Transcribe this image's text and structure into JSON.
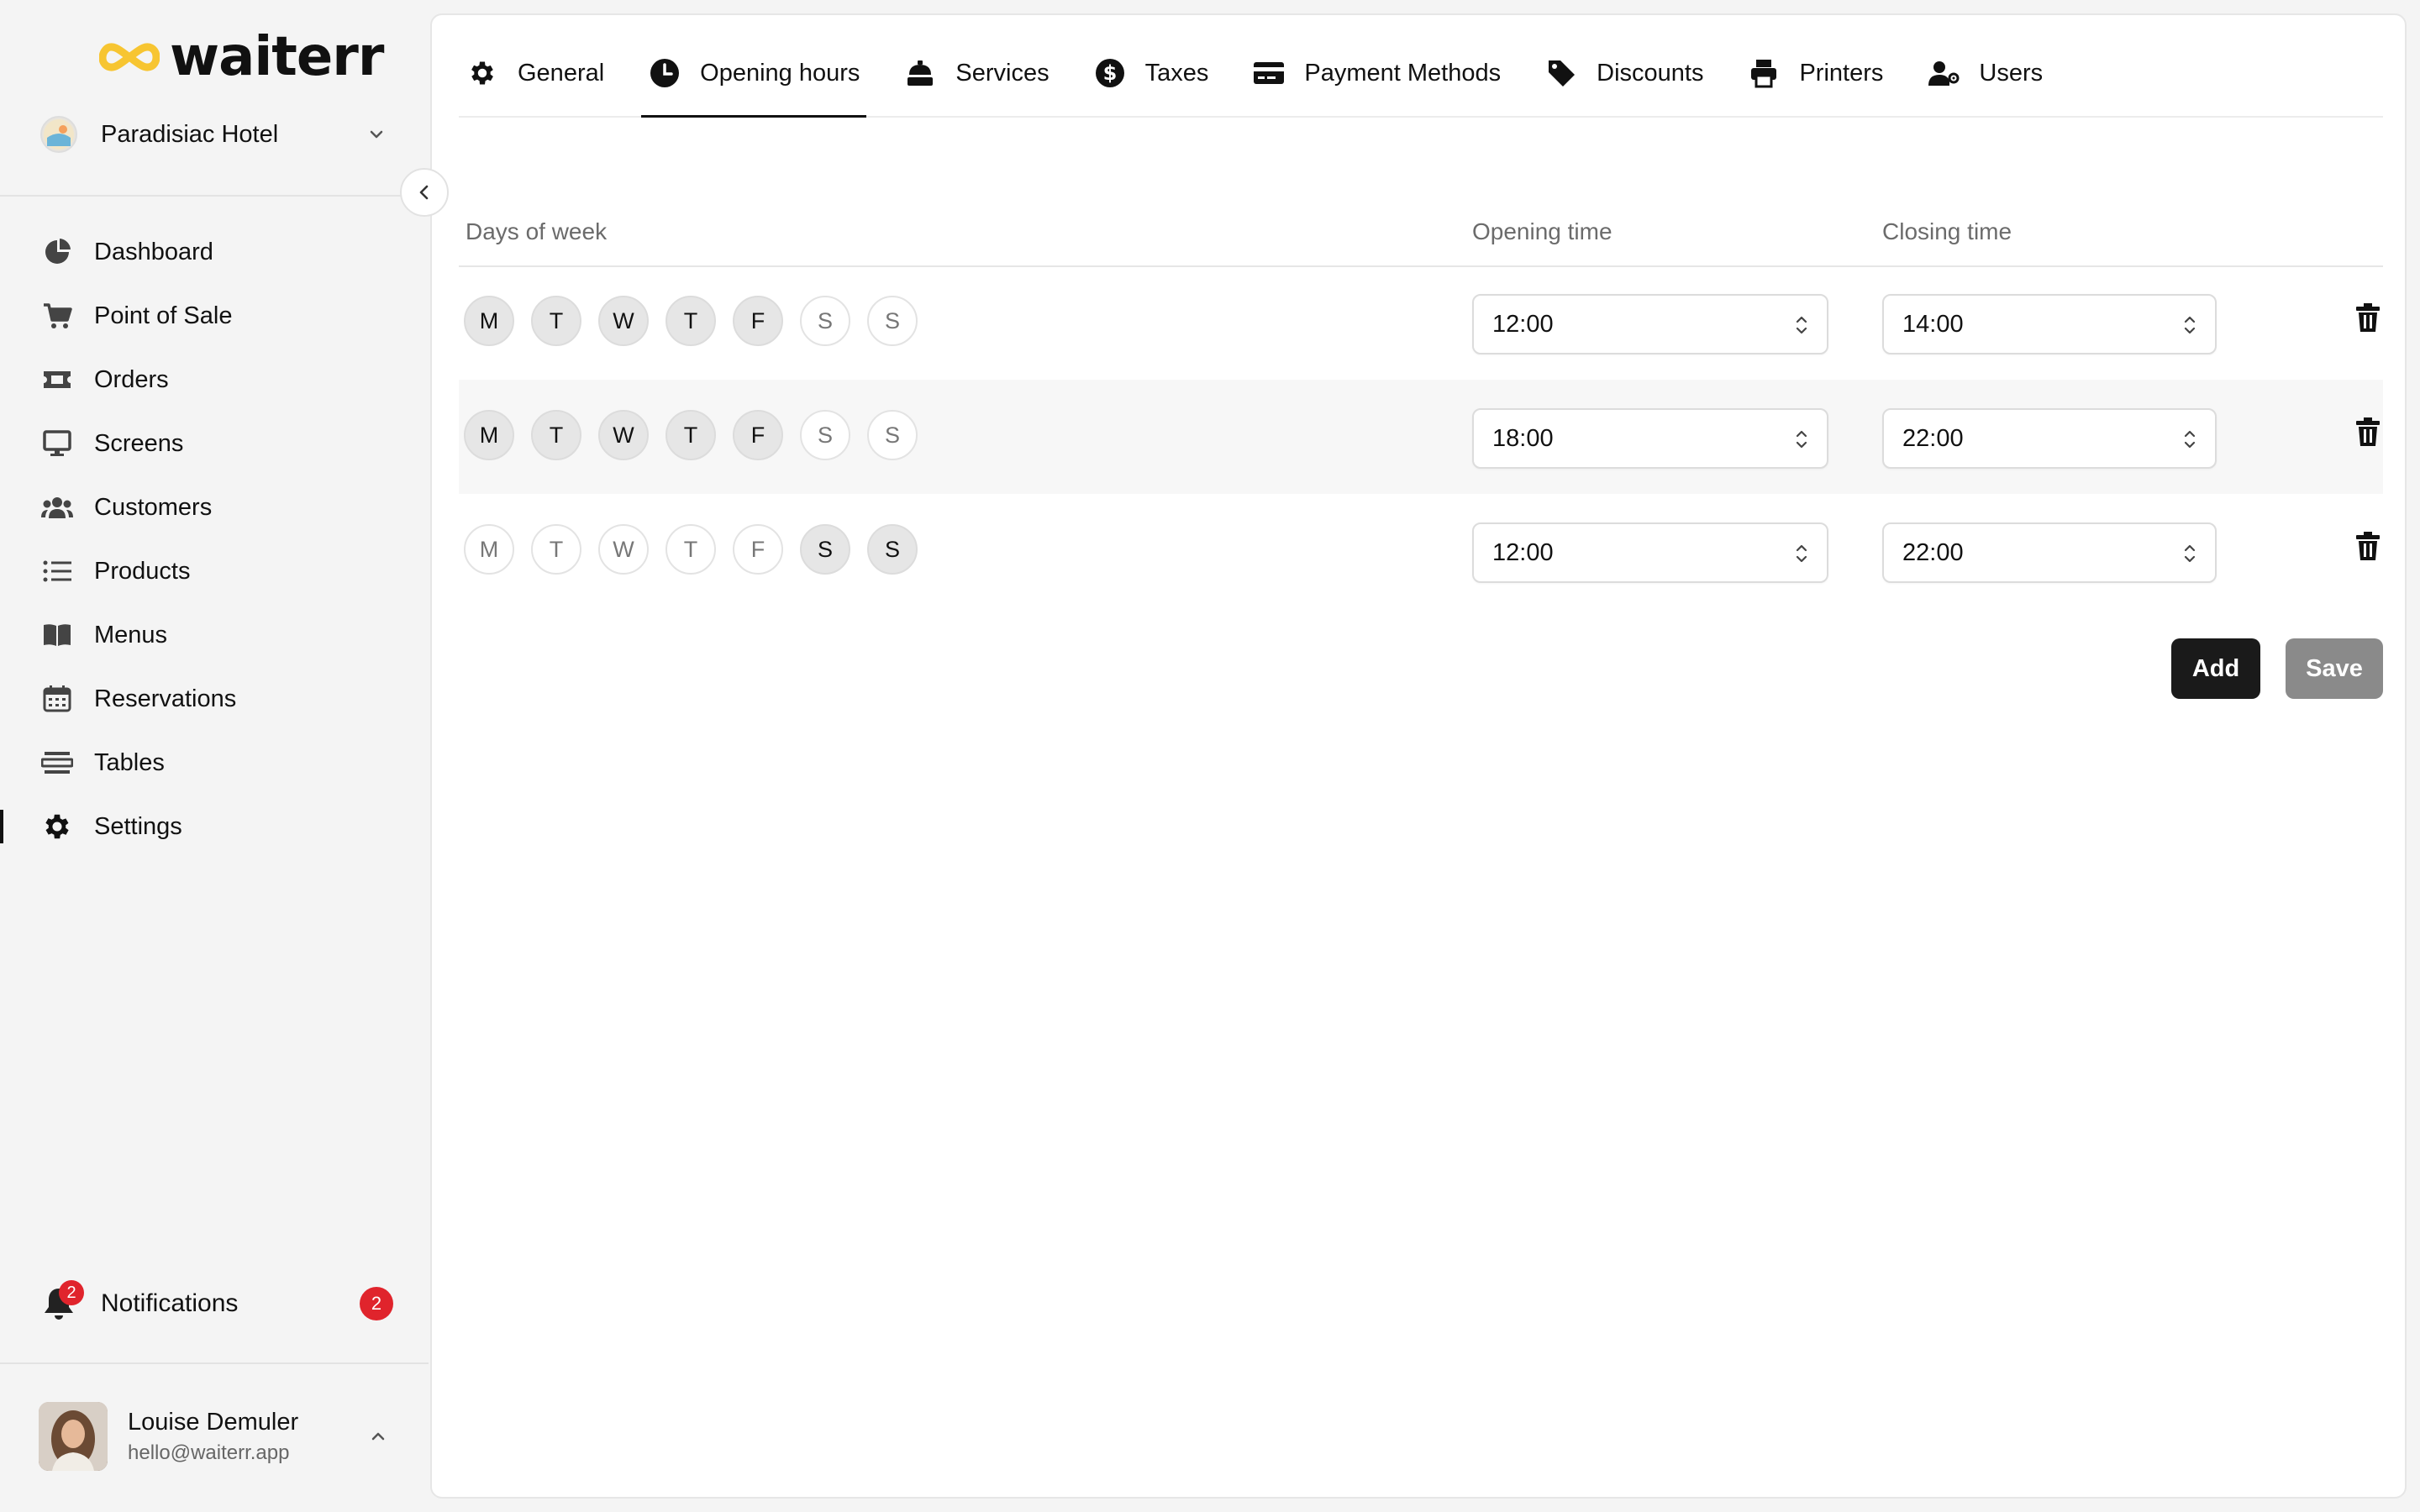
{
  "app": {
    "brand": "waiterr"
  },
  "hotel": {
    "name": "Paradisiac Hotel"
  },
  "sidebar": {
    "items": [
      {
        "label": "Dashboard",
        "icon": "pie-chart-icon"
      },
      {
        "label": "Point of Sale",
        "icon": "cart-icon"
      },
      {
        "label": "Orders",
        "icon": "ticket-icon"
      },
      {
        "label": "Screens",
        "icon": "monitor-icon"
      },
      {
        "label": "Customers",
        "icon": "users-group-icon"
      },
      {
        "label": "Products",
        "icon": "list-icon"
      },
      {
        "label": "Menus",
        "icon": "book-icon"
      },
      {
        "label": "Reservations",
        "icon": "calendar-icon"
      },
      {
        "label": "Tables",
        "icon": "table-icon"
      },
      {
        "label": "Settings",
        "icon": "gear-icon",
        "active": true
      }
    ],
    "notifications": {
      "label": "Notifications",
      "count": "2"
    },
    "user": {
      "name": "Louise Demuler",
      "email": "hello@waiterr.app"
    }
  },
  "tabs": [
    {
      "label": "General",
      "icon": "gear-icon"
    },
    {
      "label": "Opening hours",
      "icon": "clock-icon",
      "active": true
    },
    {
      "label": "Services",
      "icon": "services-icon"
    },
    {
      "label": "Taxes",
      "icon": "dollar-icon"
    },
    {
      "label": "Payment Methods",
      "icon": "credit-card-icon"
    },
    {
      "label": "Discounts",
      "icon": "tag-icon"
    },
    {
      "label": "Printers",
      "icon": "printer-icon"
    },
    {
      "label": "Users",
      "icon": "user-cog-icon"
    }
  ],
  "table": {
    "headers": {
      "days": "Days of week",
      "opening": "Opening time",
      "closing": "Closing time"
    },
    "day_letters": [
      "M",
      "T",
      "W",
      "T",
      "F",
      "S",
      "S"
    ],
    "rows": [
      {
        "days_on": [
          true,
          true,
          true,
          true,
          true,
          false,
          false
        ],
        "opening": "12:00",
        "closing": "14:00"
      },
      {
        "days_on": [
          true,
          true,
          true,
          true,
          true,
          false,
          false
        ],
        "opening": "18:00",
        "closing": "22:00"
      },
      {
        "days_on": [
          false,
          false,
          false,
          false,
          false,
          true,
          true
        ],
        "opening": "12:00",
        "closing": "22:00"
      }
    ]
  },
  "actions": {
    "add": "Add",
    "save": "Save"
  },
  "colors": {
    "accent": "#111111",
    "logo": "#f7c531",
    "badge": "#e0242c",
    "save_disabled": "#8a8a8a"
  }
}
